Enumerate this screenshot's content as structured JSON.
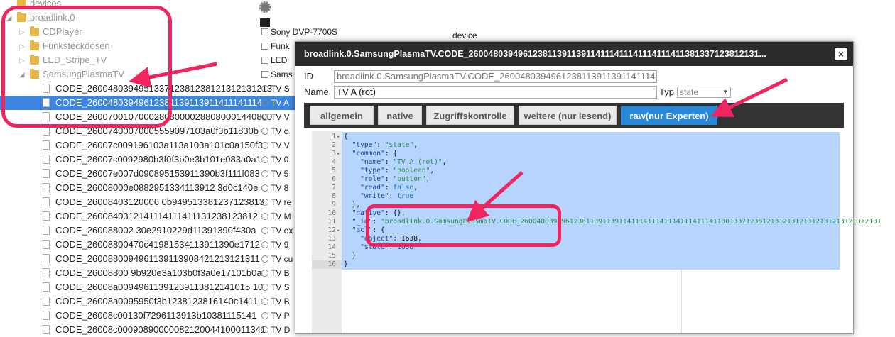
{
  "tree": {
    "rows": [
      {
        "name": "devices",
        "kind": "folder",
        "indent": 1,
        "arrow": "",
        "gray": true
      },
      {
        "name": "broadlink.0",
        "kind": "folder",
        "indent": 1,
        "arrow": "◢",
        "gray": true
      },
      {
        "name": "CDPlayer",
        "kind": "folder",
        "indent": 2,
        "arrow": "▷",
        "gray": true
      },
      {
        "name": "Funksteckdosen",
        "kind": "folder",
        "indent": 2,
        "arrow": "▷",
        "gray": true
      },
      {
        "name": "LED_Stripe_TV",
        "kind": "folder",
        "indent": 2,
        "arrow": "▷",
        "gray": true
      },
      {
        "name": "SamsungPlasmaTV",
        "kind": "folder",
        "indent": 2,
        "arrow": "◢",
        "gray": true
      },
      {
        "name": "CODE_260048039495133712381238121312131213",
        "kind": "doc",
        "indent": 3
      },
      {
        "name": "CODE_2600480394961238113911391141114111411",
        "kind": "doc",
        "indent": 3,
        "selected": true
      },
      {
        "name": "CODE_260070010700028080000288080001440800",
        "kind": "doc",
        "indent": 3
      },
      {
        "name": "CODE_26007400070005559097103a0f3b11830b",
        "kind": "doc",
        "indent": 3
      },
      {
        "name": "CODE_26007c009196103a113a103a101c0a150f3",
        "kind": "doc",
        "indent": 3
      },
      {
        "name": "CODE_26007c0092980b3f0f3b0e3b101e083a0a1",
        "kind": "doc",
        "indent": 3
      },
      {
        "name": "CODE_26007e007d090895153911390b3f111f083",
        "kind": "doc",
        "indent": 3
      },
      {
        "name": "CODE_26008000e0882951334113912 3d0c140e",
        "kind": "doc",
        "indent": 3
      },
      {
        "name": "CODE_26008403120006 0b949513381237123813",
        "kind": "doc",
        "indent": 3
      },
      {
        "name": "CODE_2600840312141114111411131238123812",
        "kind": "doc",
        "indent": 3
      },
      {
        "name": "CODE_260088002 30e2910229d11391390f430a",
        "kind": "doc",
        "indent": 3
      },
      {
        "name": "CODE_26008800470c41981534113911390e1712",
        "kind": "doc",
        "indent": 3
      },
      {
        "name": "CODE_2600880094961139113908421213121311",
        "kind": "doc",
        "indent": 3
      },
      {
        "name": "CODE_26008800 9b920e3a103b0f3a0e17101b0a",
        "kind": "doc",
        "indent": 3
      },
      {
        "name": "CODE_26008a00949611391239113812141015 10",
        "kind": "doc",
        "indent": 3
      },
      {
        "name": "CODE_26008a0095950f3b1238123816140c1411",
        "kind": "doc",
        "indent": 3
      },
      {
        "name": "CODE_26008c00130f7296113913b10381115141",
        "kind": "doc",
        "indent": 3
      },
      {
        "name": "CODE_26008c00090890000082120044100011341",
        "kind": "doc",
        "indent": 3
      }
    ],
    "col2": [
      {
        "row": 2,
        "icon": "state",
        "text": "Sony DVP-7700S"
      },
      {
        "row": 3,
        "icon": "state",
        "text": "Funk"
      },
      {
        "row": 4,
        "icon": "state",
        "text": "LED"
      },
      {
        "row": 5,
        "icon": "state",
        "text": "Sams"
      },
      {
        "row": 6,
        "icon": "radio",
        "text": "TV S"
      },
      {
        "row": 7,
        "icon": "radio",
        "text": "TV A"
      },
      {
        "row": 8,
        "icon": "radio",
        "text": "TV V"
      },
      {
        "row": 9,
        "icon": "radio",
        "text": "TV c"
      },
      {
        "row": 10,
        "icon": "radio",
        "text": "TV V"
      },
      {
        "row": 11,
        "icon": "radio",
        "text": "TV 0"
      },
      {
        "row": 12,
        "icon": "radio",
        "text": "TV 5"
      },
      {
        "row": 13,
        "icon": "radio",
        "text": "TV 8"
      },
      {
        "row": 14,
        "icon": "radio",
        "text": "TV re"
      },
      {
        "row": 15,
        "icon": "radio",
        "text": "TV M"
      },
      {
        "row": 16,
        "icon": "radio",
        "text": "TV ex"
      },
      {
        "row": 17,
        "icon": "radio",
        "text": "TV 9"
      },
      {
        "row": 18,
        "icon": "radio",
        "text": "TV cu"
      },
      {
        "row": 19,
        "icon": "radio",
        "text": "TV B"
      },
      {
        "row": 20,
        "icon": "radio",
        "text": "TV S"
      },
      {
        "row": 21,
        "icon": "radio",
        "text": "TV B"
      },
      {
        "row": 22,
        "icon": "radio",
        "text": "TV P"
      },
      {
        "row": 23,
        "icon": "radio",
        "text": "TV D"
      }
    ],
    "col3_text": "device"
  },
  "dialog": {
    "title": "broadlink.0.SamsungPlasmaTV.CODE_260048039496123811391139114111411141114111411381337123812131...",
    "close_label": "×",
    "id_label": "ID",
    "id_value": "broadlink.0.SamsungPlasmaTV.CODE_260048039496123811391139114111411141114111411",
    "name_label": "Name",
    "name_value": "TV A (rot)",
    "typ_label": "Typ",
    "typ_value": "state",
    "tabs": [
      {
        "label": "allgemein",
        "active": false
      },
      {
        "label": "native",
        "active": false
      },
      {
        "label": "Zugriffskontrolle",
        "active": false
      },
      {
        "label": "weitere (nur lesend)",
        "active": false
      },
      {
        "label": "raw(nur Experten)",
        "active": true
      }
    ],
    "editor": {
      "lines": [
        {
          "n": "1",
          "fold": true,
          "tokens": [
            [
              "p",
              "{"
            ]
          ]
        },
        {
          "n": "2",
          "fold": false,
          "tokens": [
            [
              "p",
              "  "
            ],
            [
              "k",
              "\"type\""
            ],
            [
              "p",
              ": "
            ],
            [
              "s",
              "\"state\""
            ],
            [
              "p",
              ","
            ]
          ]
        },
        {
          "n": "3",
          "fold": true,
          "tokens": [
            [
              "p",
              "  "
            ],
            [
              "k",
              "\"common\""
            ],
            [
              "p",
              ": {"
            ]
          ]
        },
        {
          "n": "4",
          "fold": false,
          "tokens": [
            [
              "p",
              "    "
            ],
            [
              "k",
              "\"name\""
            ],
            [
              "p",
              ": "
            ],
            [
              "s",
              "\"TV A (rot)\""
            ],
            [
              "p",
              ","
            ]
          ]
        },
        {
          "n": "5",
          "fold": false,
          "tokens": [
            [
              "p",
              "    "
            ],
            [
              "k",
              "\"type\""
            ],
            [
              "p",
              ": "
            ],
            [
              "s",
              "\"boolean\""
            ],
            [
              "p",
              ","
            ]
          ]
        },
        {
          "n": "6",
          "fold": false,
          "tokens": [
            [
              "p",
              "    "
            ],
            [
              "k",
              "\"role\""
            ],
            [
              "p",
              ": "
            ],
            [
              "s",
              "\"button\""
            ],
            [
              "p",
              ","
            ]
          ]
        },
        {
          "n": "7",
          "fold": false,
          "tokens": [
            [
              "p",
              "    "
            ],
            [
              "k",
              "\"read\""
            ],
            [
              "p",
              ": "
            ],
            [
              "b",
              "false"
            ],
            [
              "p",
              ","
            ]
          ]
        },
        {
          "n": "8",
          "fold": false,
          "tokens": [
            [
              "p",
              "    "
            ],
            [
              "k",
              "\"write\""
            ],
            [
              "p",
              ": "
            ],
            [
              "b",
              "true"
            ]
          ]
        },
        {
          "n": "9",
          "fold": false,
          "tokens": [
            [
              "p",
              "  },"
            ]
          ]
        },
        {
          "n": "10",
          "fold": false,
          "tokens": [
            [
              "p",
              "  "
            ],
            [
              "k",
              "\"native\""
            ],
            [
              "p",
              ": {},"
            ]
          ]
        },
        {
          "n": "11",
          "fold": false,
          "tokens": [
            [
              "p",
              "  "
            ],
            [
              "k",
              "\"_id\""
            ],
            [
              "p",
              ": "
            ],
            [
              "s",
              "\"broadlink.0.SamsungPlasmaTV.CODE_2600480394961238113911391141114111411141114111411381337123812131213121312131213121312131"
            ]
          ]
        },
        {
          "n": "12",
          "fold": true,
          "tokens": [
            [
              "p",
              "  "
            ],
            [
              "k",
              "\"acl\""
            ],
            [
              "p",
              ": {"
            ]
          ]
        },
        {
          "n": "13",
          "fold": false,
          "tokens": [
            [
              "p",
              "    "
            ],
            [
              "k",
              "\"object\""
            ],
            [
              "p",
              ": 1638,"
            ]
          ]
        },
        {
          "n": "14",
          "fold": false,
          "tokens": [
            [
              "p",
              "    "
            ],
            [
              "k",
              "\"state\""
            ],
            [
              "p",
              ": "
            ],
            [
              "n",
              "1638"
            ]
          ]
        },
        {
          "n": "15",
          "fold": false,
          "tokens": [
            [
              "p",
              "  }"
            ]
          ]
        },
        {
          "n": "16",
          "fold": false,
          "tokens": [
            [
              "p",
              "}"
            ]
          ]
        }
      ]
    }
  },
  "colors": {
    "annotation": "#f0245e",
    "tab_active": "#2a88d8",
    "selection": "#b5d5ff",
    "tree_selected": "#3b84e0"
  }
}
